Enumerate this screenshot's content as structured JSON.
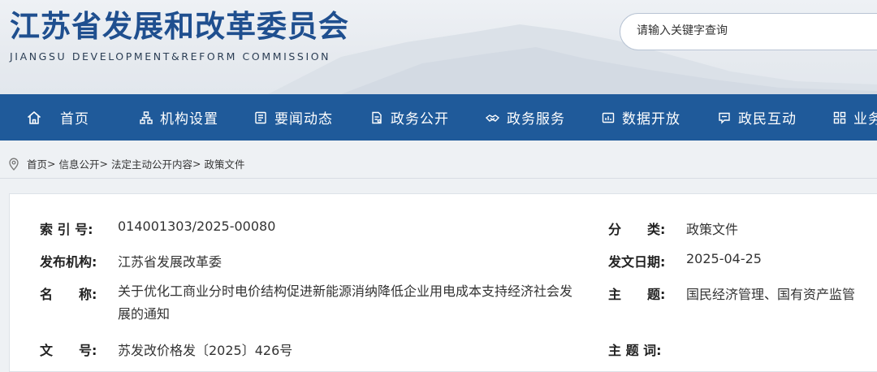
{
  "header": {
    "title": "江苏省发展和改革委员会",
    "subtitle": "JIANGSU DEVELOPMENT&REFORM COMMISSION",
    "search_placeholder": "请输入关键字查询"
  },
  "nav": {
    "items": [
      {
        "label": "首页",
        "icon": "home-icon"
      },
      {
        "label": "机构设置",
        "icon": "org-chart-icon"
      },
      {
        "label": "要闻动态",
        "icon": "news-icon"
      },
      {
        "label": "政务公开",
        "icon": "document-icon"
      },
      {
        "label": "政务服务",
        "icon": "service-icon"
      },
      {
        "label": "数据开放",
        "icon": "data-icon"
      },
      {
        "label": "政民互动",
        "icon": "chat-icon"
      },
      {
        "label": "业务",
        "icon": "grid-icon"
      }
    ]
  },
  "breadcrumb": {
    "items": [
      "首页",
      "信息公开",
      "法定主动公开内容",
      "政策文件"
    ],
    "separator": ">"
  },
  "meta": {
    "index_label": "索 引 号:",
    "index_value": "014001303/2025-00080",
    "publisher_label": "发布机构:",
    "publisher_value": "江苏省发展改革委",
    "name_label": "名　　称:",
    "name_value": "关于优化工商业分时电价结构促进新能源消纳降低企业用电成本支持经济社会发展的通知",
    "docno_label": "文　　号:",
    "docno_value": "苏发改价格发〔2025〕426号",
    "category_label": "分　　类:",
    "category_value": "政策文件",
    "date_label": "发文日期:",
    "date_value": "2025-04-25",
    "topic_label": "主　　题:",
    "topic_value": "国民经济管理、国有资产监管",
    "keywords_label": "主 题 词:",
    "keywords_value": ""
  },
  "colors": {
    "brand": "#1f4f8f",
    "nav_bg": "#1f5a9a"
  }
}
